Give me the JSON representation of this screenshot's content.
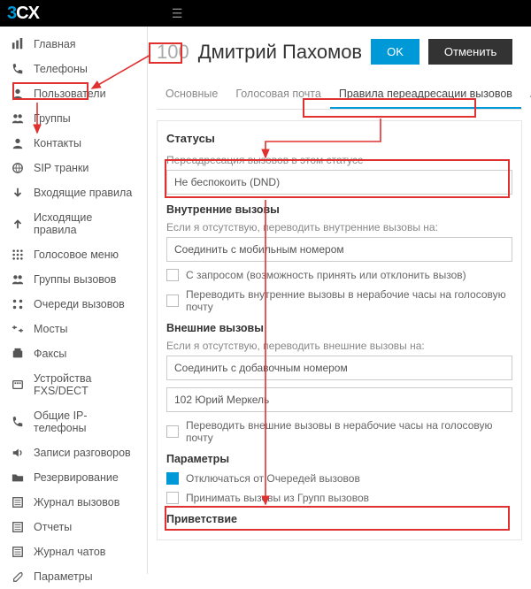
{
  "brand": "3CX",
  "sidebar": {
    "items": [
      {
        "label": "Главная"
      },
      {
        "label": "Телефоны"
      },
      {
        "label": "Пользователи"
      },
      {
        "label": "Группы"
      },
      {
        "label": "Контакты"
      },
      {
        "label": "SIP транки"
      },
      {
        "label": "Входящие правила"
      },
      {
        "label": "Исходящие правила"
      },
      {
        "label": "Голосовое меню"
      },
      {
        "label": "Группы вызовов"
      },
      {
        "label": "Очереди вызовов"
      },
      {
        "label": "Мосты"
      },
      {
        "label": "Факсы"
      },
      {
        "label": "Устройства FXS/DECT"
      },
      {
        "label": "Общие IP-телефоны"
      },
      {
        "label": "Записи разговоров"
      },
      {
        "label": "Резервирование"
      },
      {
        "label": "Журнал вызовов"
      },
      {
        "label": "Отчеты"
      },
      {
        "label": "Журнал чатов"
      },
      {
        "label": "Параметры"
      }
    ]
  },
  "header": {
    "extension": "100",
    "name": "Дмитрий Пахомов",
    "ok": "OK",
    "cancel": "Отменить"
  },
  "tabs": {
    "items": [
      {
        "label": "Основные"
      },
      {
        "label": "Голосовая почта"
      },
      {
        "label": "Правила переадресации вызовов"
      },
      {
        "label": "Автонастройка"
      }
    ],
    "activeIndex": 2
  },
  "statuses": {
    "title": "Статусы",
    "forward_label": "Переадресация вызовов в этом статусе",
    "forward_value": "Не беспокоить (DND)",
    "internal_title": "Внутренние вызовы",
    "internal_desc": "Если я отсутствую, переводить внутренние вызовы на:",
    "internal_value": "Соединить с мобильным номером",
    "chk_with_request": "С запросом (возможность принять или отклонить вызов)",
    "chk_internal_offhours": "Переводить внутренние вызовы в нерабочие часы на голосовую почту",
    "external_title": "Внешние вызовы",
    "external_desc": "Если я отсутствую, переводить внешние вызовы на:",
    "external_value": "Соединить с добавочным номером",
    "external_ext": "102 Юрий Меркель",
    "chk_external_offhours": "Переводить внешние вызовы в нерабочие часы на голосовую почту",
    "params_title": "Параметры",
    "chk_logout_queues": "Отключаться от Очередей вызовов",
    "chk_accept_groups": "Принимать вызовы из Групп вызовов",
    "greeting_title": "Приветствие"
  }
}
